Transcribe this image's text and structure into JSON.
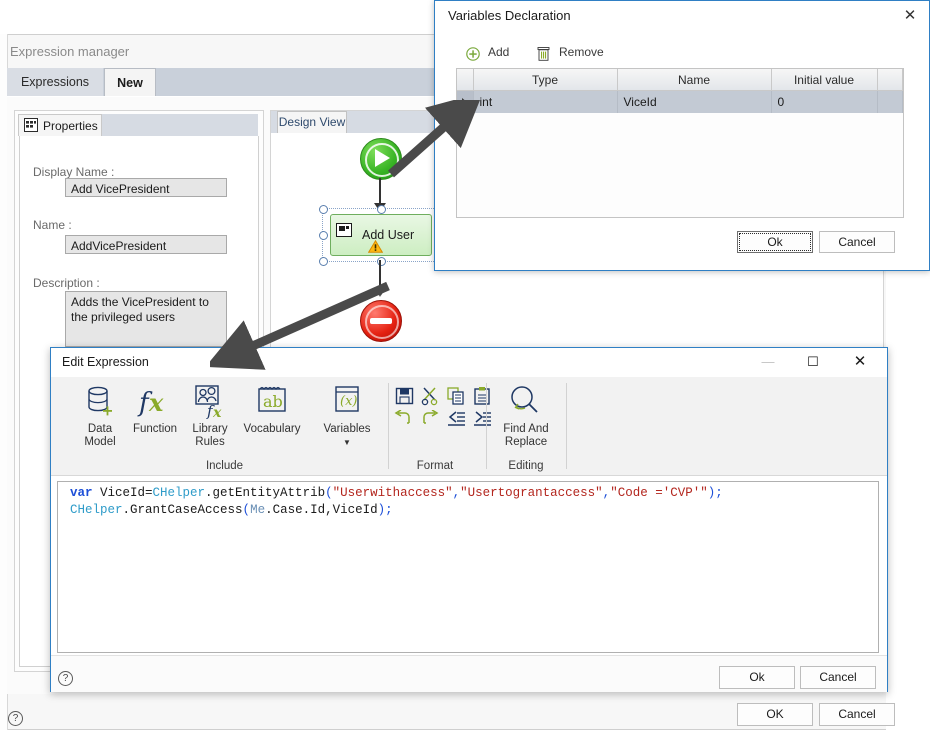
{
  "background_window": {
    "title": "Expression manager",
    "tabs": [
      {
        "label": "Expressions",
        "selected": false
      },
      {
        "label": "New",
        "selected": true
      }
    ],
    "properties_panel": {
      "tab_label": "Properties",
      "tab_icon": "properties-grid-icon",
      "fields": [
        {
          "label": "Display Name :",
          "value": "Add VicePresident"
        },
        {
          "label": "Name :",
          "value": "AddVicePresident"
        },
        {
          "label": "Description :",
          "value": "Adds the VicePresident to the privileged users"
        }
      ]
    },
    "design_panel": {
      "tab_label": "Design View",
      "nodes": [
        {
          "type": "start",
          "icon": "play-start-icon",
          "label": ""
        },
        {
          "type": "activity",
          "icon": "activity-icon",
          "label": "Add User",
          "warning_icon": "warning-triangle-icon"
        },
        {
          "type": "end",
          "icon": "stop-end-icon",
          "label": ""
        }
      ]
    },
    "help_icon": "help-question-icon",
    "buttons": {
      "ok": "OK",
      "cancel": "Cancel"
    }
  },
  "variables_dialog": {
    "title": "Variables Declaration",
    "close_icon": "close-icon",
    "toolbar": {
      "add_label": "Add",
      "add_icon": "plus-circle-icon",
      "remove_label": "Remove",
      "remove_icon": "trash-icon"
    },
    "grid": {
      "columns": [
        "Type",
        "Name",
        "Initial value"
      ],
      "rows": [
        {
          "selector": "row-selector-arrow",
          "type": "int",
          "name": "ViceId",
          "initial_value": "0"
        }
      ]
    },
    "buttons": {
      "ok": "Ok",
      "cancel": "Cancel"
    }
  },
  "edit_expression_dialog": {
    "title": "Edit Expression",
    "window_controls": {
      "minimize": "minimize-icon",
      "maximize": "maximize-icon",
      "close": "close-icon"
    },
    "ribbon": {
      "groups": [
        {
          "name": "Include",
          "label": "Include",
          "buttons": [
            {
              "label_line1": "Data",
              "label_line2": "Model",
              "icon": "database-add-icon"
            },
            {
              "label_line1": "Function",
              "label_line2": "",
              "icon": "fx-function-icon"
            },
            {
              "label_line1": "Library",
              "label_line2": "Rules",
              "icon": "library-rules-icon"
            },
            {
              "label_line1": "Vocabulary",
              "label_line2": "",
              "icon": "vocabulary-ab-icon"
            },
            {
              "label_line1": "Variables",
              "label_line2": "",
              "icon": "variables-x-icon",
              "has_dropdown": true
            }
          ]
        },
        {
          "name": "Format",
          "label": "Format",
          "buttons": [
            {
              "icon": "save-icon"
            },
            {
              "icon": "cut-scissors-icon"
            },
            {
              "icon": "copy-icon"
            },
            {
              "icon": "paste-icon"
            },
            {
              "icon": "undo-icon"
            },
            {
              "icon": "redo-icon"
            },
            {
              "icon": "outdent-icon"
            },
            {
              "icon": "indent-icon"
            }
          ]
        },
        {
          "name": "Editing",
          "label": "Editing",
          "buttons": [
            {
              "label_line1": "Find And",
              "label_line2": "Replace",
              "icon": "find-replace-magnifier-icon"
            }
          ]
        }
      ]
    },
    "code": {
      "line1": {
        "kw": "var",
        "var_name": " ViceId=",
        "cls": "CHelper",
        "method": ".getEntityAttrib",
        "open": "(",
        "arg1": "\"Userwithaccess\"",
        "c1": ",",
        "arg2": "\"Usertograntaccess\"",
        "c2": ",",
        "arg3": "\"Code ='CVP'\"",
        "close": ");"
      },
      "line2": {
        "cls": "CHelper",
        "method": ".GrantCaseAccess",
        "open": "(",
        "a1": "Me",
        "d1": ".Case.Id,",
        "a2": "ViceId",
        "close": ");"
      },
      "plain_text": "var ViceId=CHelper.getEntityAttrib(\"Userwithaccess\",\"Usertograntaccess\",\"Code ='CVP'\");\nCHelper.GrantCaseAccess(Me.Case.Id,ViceId);"
    },
    "help_icon": "help-question-icon",
    "buttons": {
      "ok": "Ok",
      "cancel": "Cancel"
    }
  },
  "annotations": {
    "arrows": [
      {
        "name": "arrow-to-variables-dialog",
        "from": "activity-node",
        "to": "variables-grid"
      },
      {
        "name": "arrow-to-edit-expression-dialog",
        "from": "activity-node",
        "to": "edit-expression-title"
      }
    ]
  },
  "colors": {
    "dialog_border": "#2f7fc4",
    "tab_strip": "#c9d0da",
    "grid_selected_row": "#c3cad4",
    "start_node_green": "#39b425",
    "end_node_red": "#e52212",
    "activity_green": "#cdeec2",
    "ribbon_icon_navy": "#1f3864",
    "ribbon_icon_olive": "#8aaa2a",
    "code_keyword": "#1d4fd8",
    "code_string": "#b3261e",
    "code_class": "#2f9cc9"
  }
}
